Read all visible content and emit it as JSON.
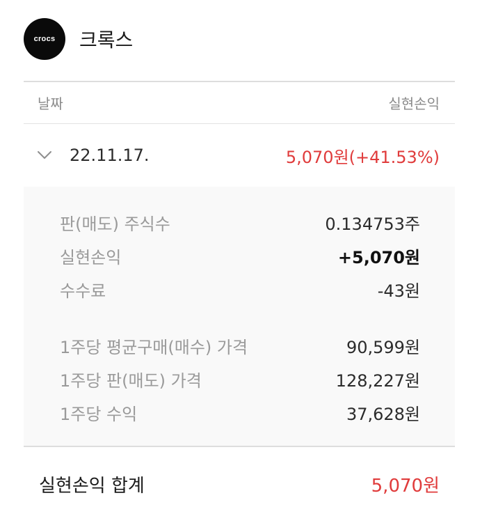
{
  "stock": {
    "logo_text": "crocs",
    "name": "크록스"
  },
  "table": {
    "col_date": "날짜",
    "col_realized": "실현손익"
  },
  "trade": {
    "date": "22.11.17.",
    "realized_summary": "5,070원(+41.53%)",
    "details": [
      {
        "label": "판(매도) 주식수",
        "value": "0.134753주",
        "bold": false
      },
      {
        "label": "실현손익",
        "value": "+5,070원",
        "bold": true
      },
      {
        "label": "수수료",
        "value": "-43원",
        "bold": false
      }
    ],
    "per_share": [
      {
        "label": "1주당 평균구매(매수) 가격",
        "value": "90,599원"
      },
      {
        "label": "1주당 판(매도) 가격",
        "value": "128,227원"
      },
      {
        "label": "1주당 수익",
        "value": "37,628원"
      }
    ]
  },
  "total": {
    "label": "실현손익 합계",
    "value": "5,070원"
  },
  "colors": {
    "profit_red": "#e03b3b",
    "detail_bg": "#f9f9f9"
  },
  "icons": {
    "logo": "crocs-logo",
    "expand": "chevron-down-icon"
  }
}
